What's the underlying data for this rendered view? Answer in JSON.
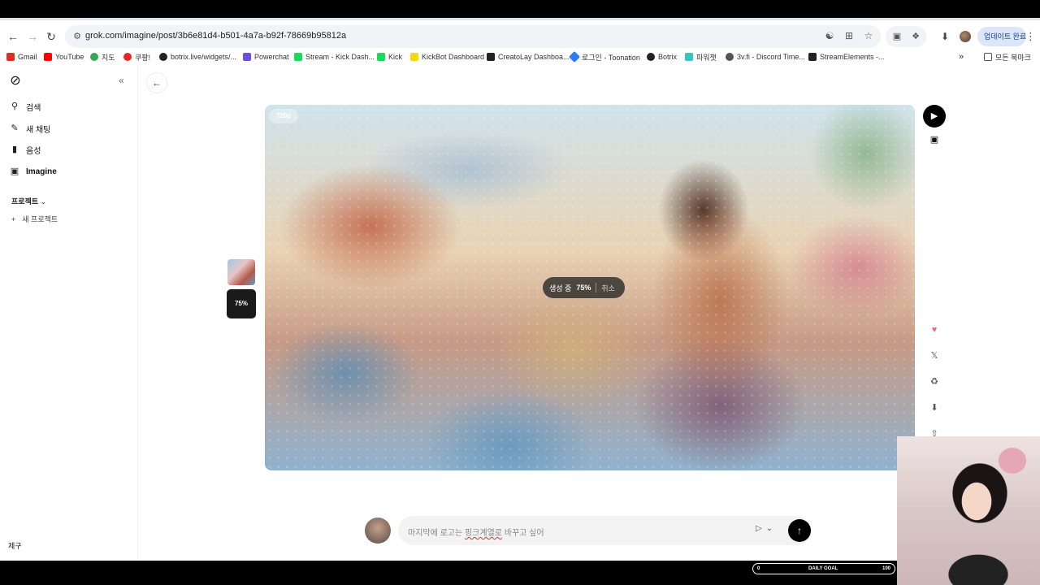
{
  "browser": {
    "url": "grok.com/imagine/post/3b6e81d4-b501-4a7a-b92f-78669b95812a",
    "update_label": "업데이트 완료",
    "bookmarks": [
      {
        "label": "Gmail",
        "color": "#d93025"
      },
      {
        "label": "YouTube",
        "color": "#ff0000"
      },
      {
        "label": "지도",
        "color": "#34a853"
      },
      {
        "label": "쿠팡!",
        "color": "#e52528"
      },
      {
        "label": "botrix.live/widgets/...",
        "color": "#222222"
      },
      {
        "label": "Powerchat",
        "color": "#6b4de6"
      },
      {
        "label": "Stream - Kick Dash...",
        "color": "#1bd95b"
      },
      {
        "label": "Kick",
        "color": "#1bd95b"
      },
      {
        "label": "KickBot Dashboard",
        "color": "#f5d90a"
      },
      {
        "label": "CreatoLay Dashboa...",
        "color": "#222222"
      },
      {
        "label": "로그인 - Toonation",
        "color": "#2f7cf6"
      },
      {
        "label": "Botrix",
        "color": "#222222"
      },
      {
        "label": "파워챗",
        "color": "#35c4c4"
      },
      {
        "label": "3v.fi - Discord Time...",
        "color": "#555555"
      },
      {
        "label": "StreamElements -...",
        "color": "#222222"
      }
    ],
    "all_bookmarks_label": "모든 북마크"
  },
  "sidebar": {
    "items": [
      {
        "label": "검색",
        "icon": "search-icon"
      },
      {
        "label": "새 채팅",
        "icon": "edit-icon"
      },
      {
        "label": "음성",
        "icon": "voice-icon"
      },
      {
        "label": "Imagine",
        "icon": "imagine-icon"
      }
    ],
    "projects_label": "프로젝트",
    "new_project_label": "새 프로젝트",
    "user_label": "제구"
  },
  "main": {
    "resolution_badge": "720p",
    "progress_label": "생성 중",
    "progress_percent": "75%",
    "progress_value": 0.75,
    "cancel_label": "취소",
    "thumb_percent": "75%"
  },
  "composer": {
    "text_before": "마지막에 로고는 ",
    "text_spell": "핑크계열로",
    "text_after": " 바꾸고 싶어"
  },
  "overlay": {
    "goal_min": "0",
    "goal_label": "DAILY GOAL",
    "goal_max": "100"
  }
}
